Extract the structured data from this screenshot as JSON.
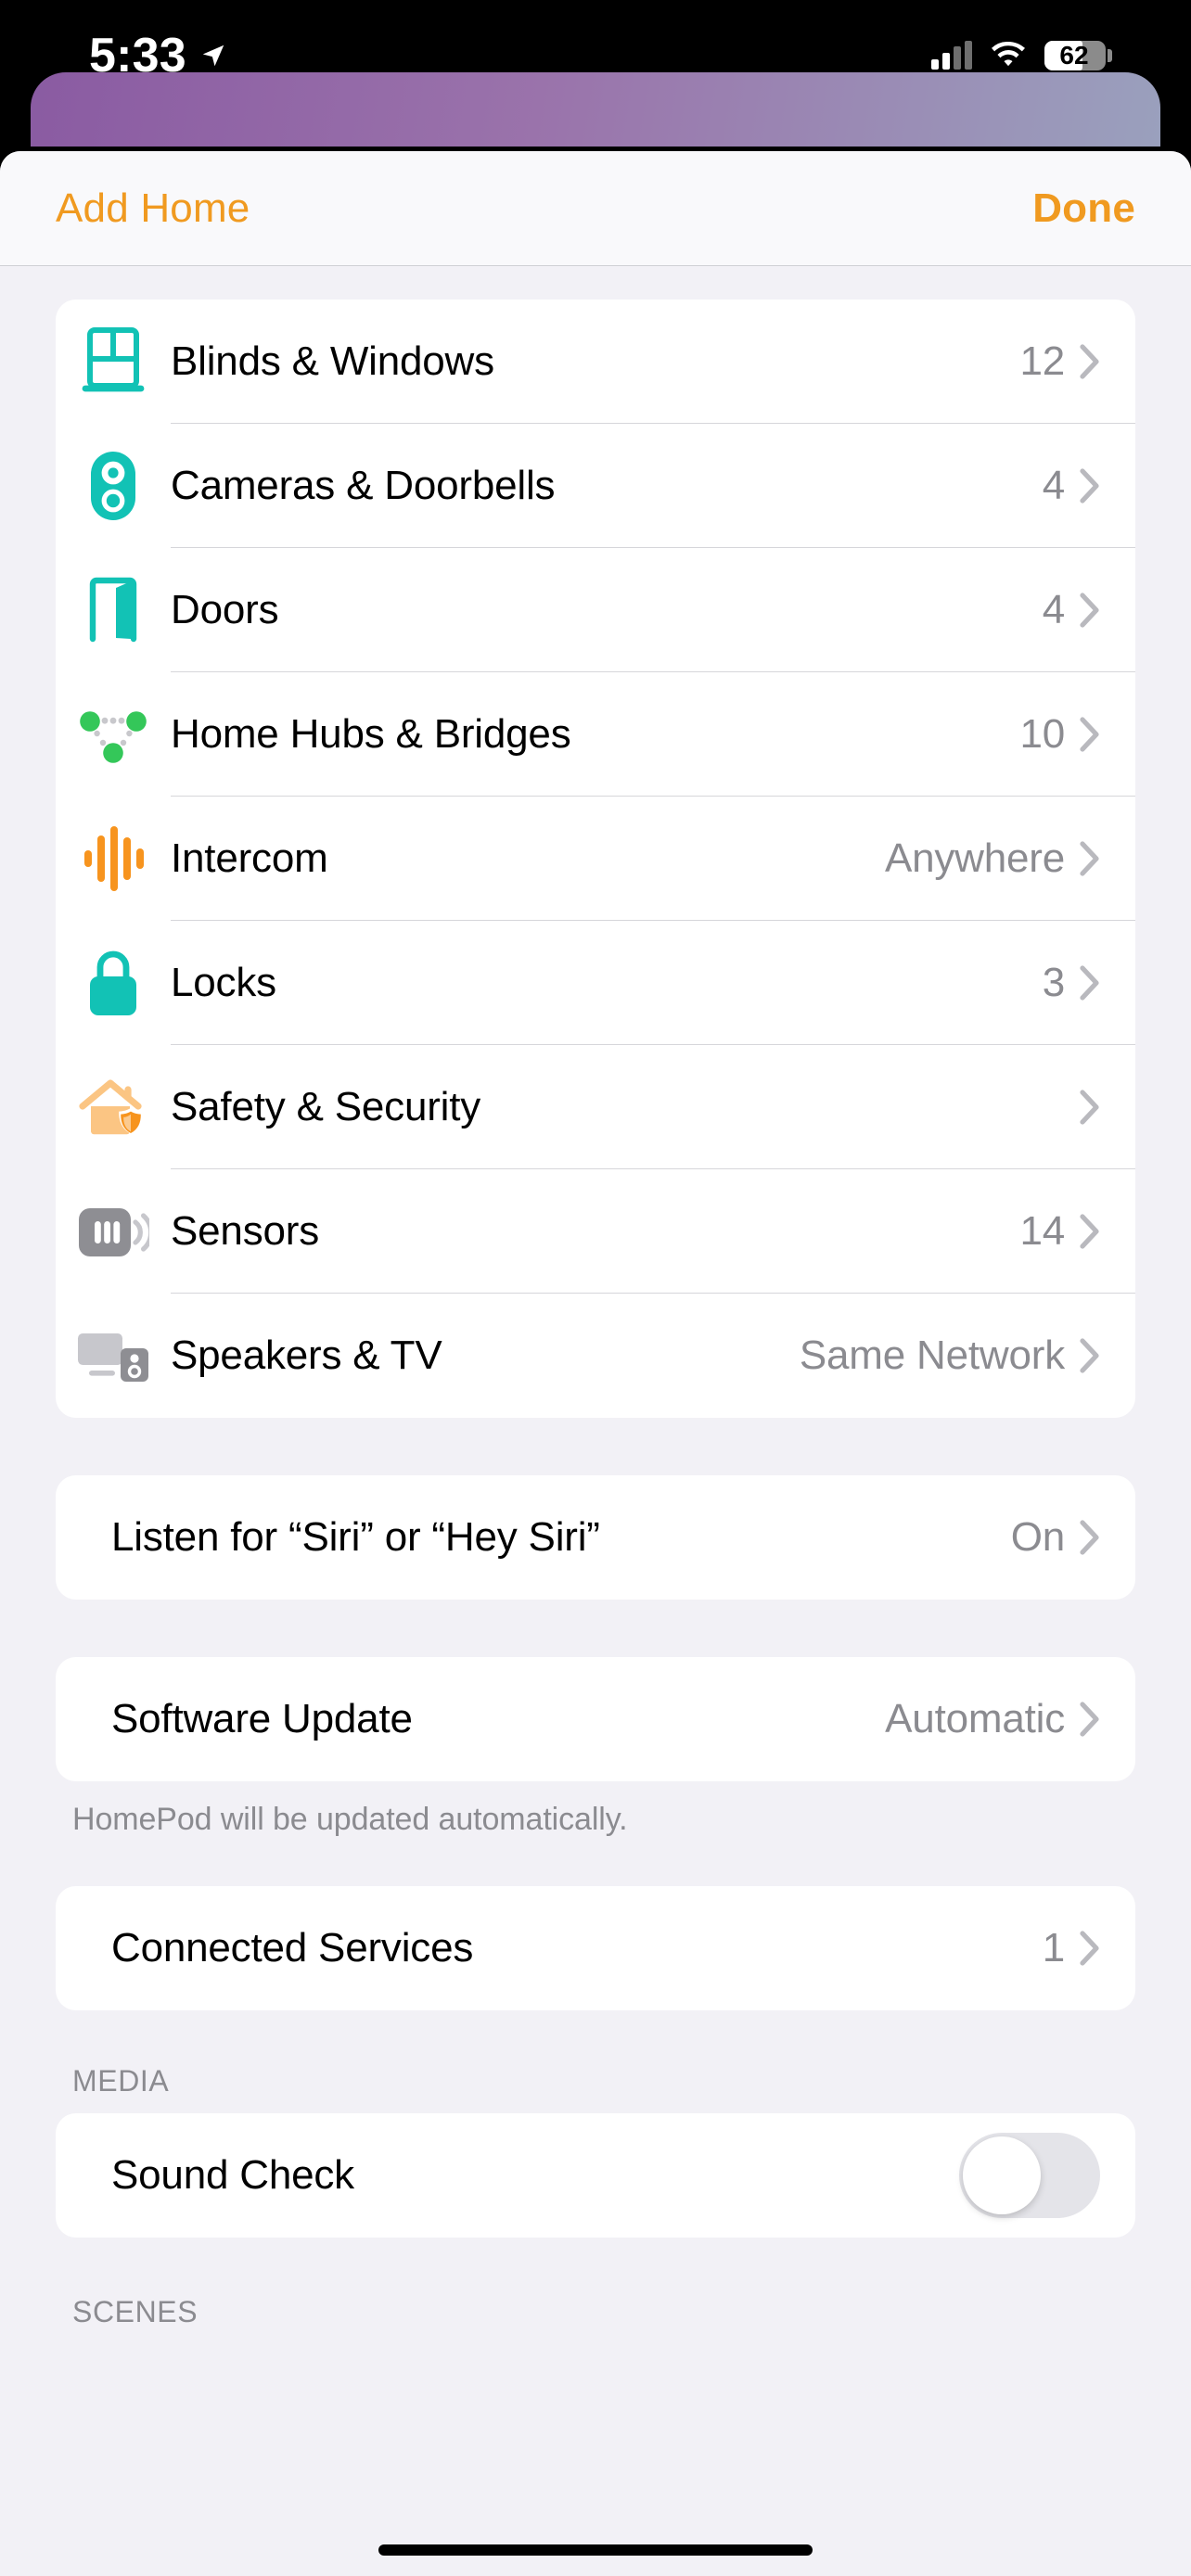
{
  "status_bar": {
    "time": "5:33",
    "battery_percent": "62",
    "location_icon": "location-arrow-icon",
    "cellular_icon": "cellular-bars-icon",
    "wifi_icon": "wifi-icon",
    "battery_icon": "battery-icon"
  },
  "nav": {
    "left_label": "Add Home",
    "right_label": "Done"
  },
  "accessory_group": {
    "rows": [
      {
        "icon": "window-icon",
        "label": "Blinds & Windows",
        "value": "12"
      },
      {
        "icon": "doorbell-camera-icon",
        "label": "Cameras & Doorbells",
        "value": "4"
      },
      {
        "icon": "door-icon",
        "label": "Doors",
        "value": "4"
      },
      {
        "icon": "hub-network-icon",
        "label": "Home Hubs & Bridges",
        "value": "10"
      },
      {
        "icon": "waveform-icon",
        "label": "Intercom",
        "value": "Anywhere"
      },
      {
        "icon": "lock-icon",
        "label": "Locks",
        "value": "3"
      },
      {
        "icon": "house-shield-icon",
        "label": "Safety & Security",
        "value": ""
      },
      {
        "icon": "sensor-icon",
        "label": "Sensors",
        "value": "14"
      },
      {
        "icon": "tv-speaker-icon",
        "label": "Speakers & TV",
        "value": "Same Network"
      }
    ]
  },
  "siri_group": {
    "label": "Listen for “Siri” or “Hey Siri”",
    "value": "On"
  },
  "software_update_group": {
    "label": "Software Update",
    "value": "Automatic",
    "footnote": "HomePod will be updated automatically."
  },
  "connected_services_group": {
    "label": "Connected Services",
    "value": "1"
  },
  "media_section": {
    "header": "MEDIA",
    "sound_check_label": "Sound Check",
    "sound_check_on": false
  },
  "scenes_section": {
    "header": "SCENES"
  },
  "colors": {
    "accent_orange": "#f09a20",
    "teal": "#12c2b5",
    "green": "#34c759",
    "orange": "#f7941e",
    "gray": "#8e8e93"
  }
}
